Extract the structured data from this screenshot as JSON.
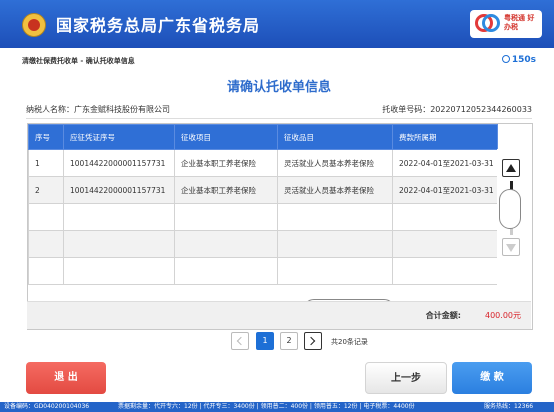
{
  "header": {
    "title": "国家税务总局广东省税务局",
    "logo_text": "粤税通 好办税"
  },
  "breadcrumb": "清缴社保费托收单 - 确认托收单信息",
  "timer": "150s",
  "page_title": "请确认托收单信息",
  "taxpayer": "纳税人名称：广东金赋科技股份有限公司",
  "order_no": "托收单号码：20220712052344260033",
  "table": {
    "columns": [
      "序号",
      "应征凭证序号",
      "征收项目",
      "征收品目",
      "费款所属期"
    ],
    "rows": [
      [
        "1",
        "10014422000001157731",
        "企业基本职工养老保险",
        "灵活就业人员基本养老保险",
        "2022-04-01至2021-03-31"
      ],
      [
        "2",
        "10014422000001157731",
        "企业基本职工养老保险",
        "灵活就业人员基本养老保险",
        "2022-04-01至2021-03-31"
      ]
    ],
    "empty_rows": 3,
    "vertical_scroll_fraction": 0.33,
    "horizontal_scroll_fraction": 0.56
  },
  "total": {
    "label": "合计金额:",
    "value": "400.00元"
  },
  "pagination": {
    "current": "1",
    "next_page": "2",
    "total_text": "共20条记录"
  },
  "buttons": {
    "exit": "退 出",
    "prev": "上一步",
    "pay": "缴 款"
  },
  "footer": {
    "device": "设备编码：GD040200104036",
    "stock": "票据剩余量：代开专六：12份 | 代开专三：3400份 | 领用普二：400份 | 领用普五：12份 | 电子税票：4400份",
    "phone": "服务热线：12366"
  },
  "colors": {
    "header_blue": "#1d4fb8",
    "accent_blue": "#2f6fd6",
    "exit_red": "#e34a42",
    "amount_red": "#d8232a"
  }
}
